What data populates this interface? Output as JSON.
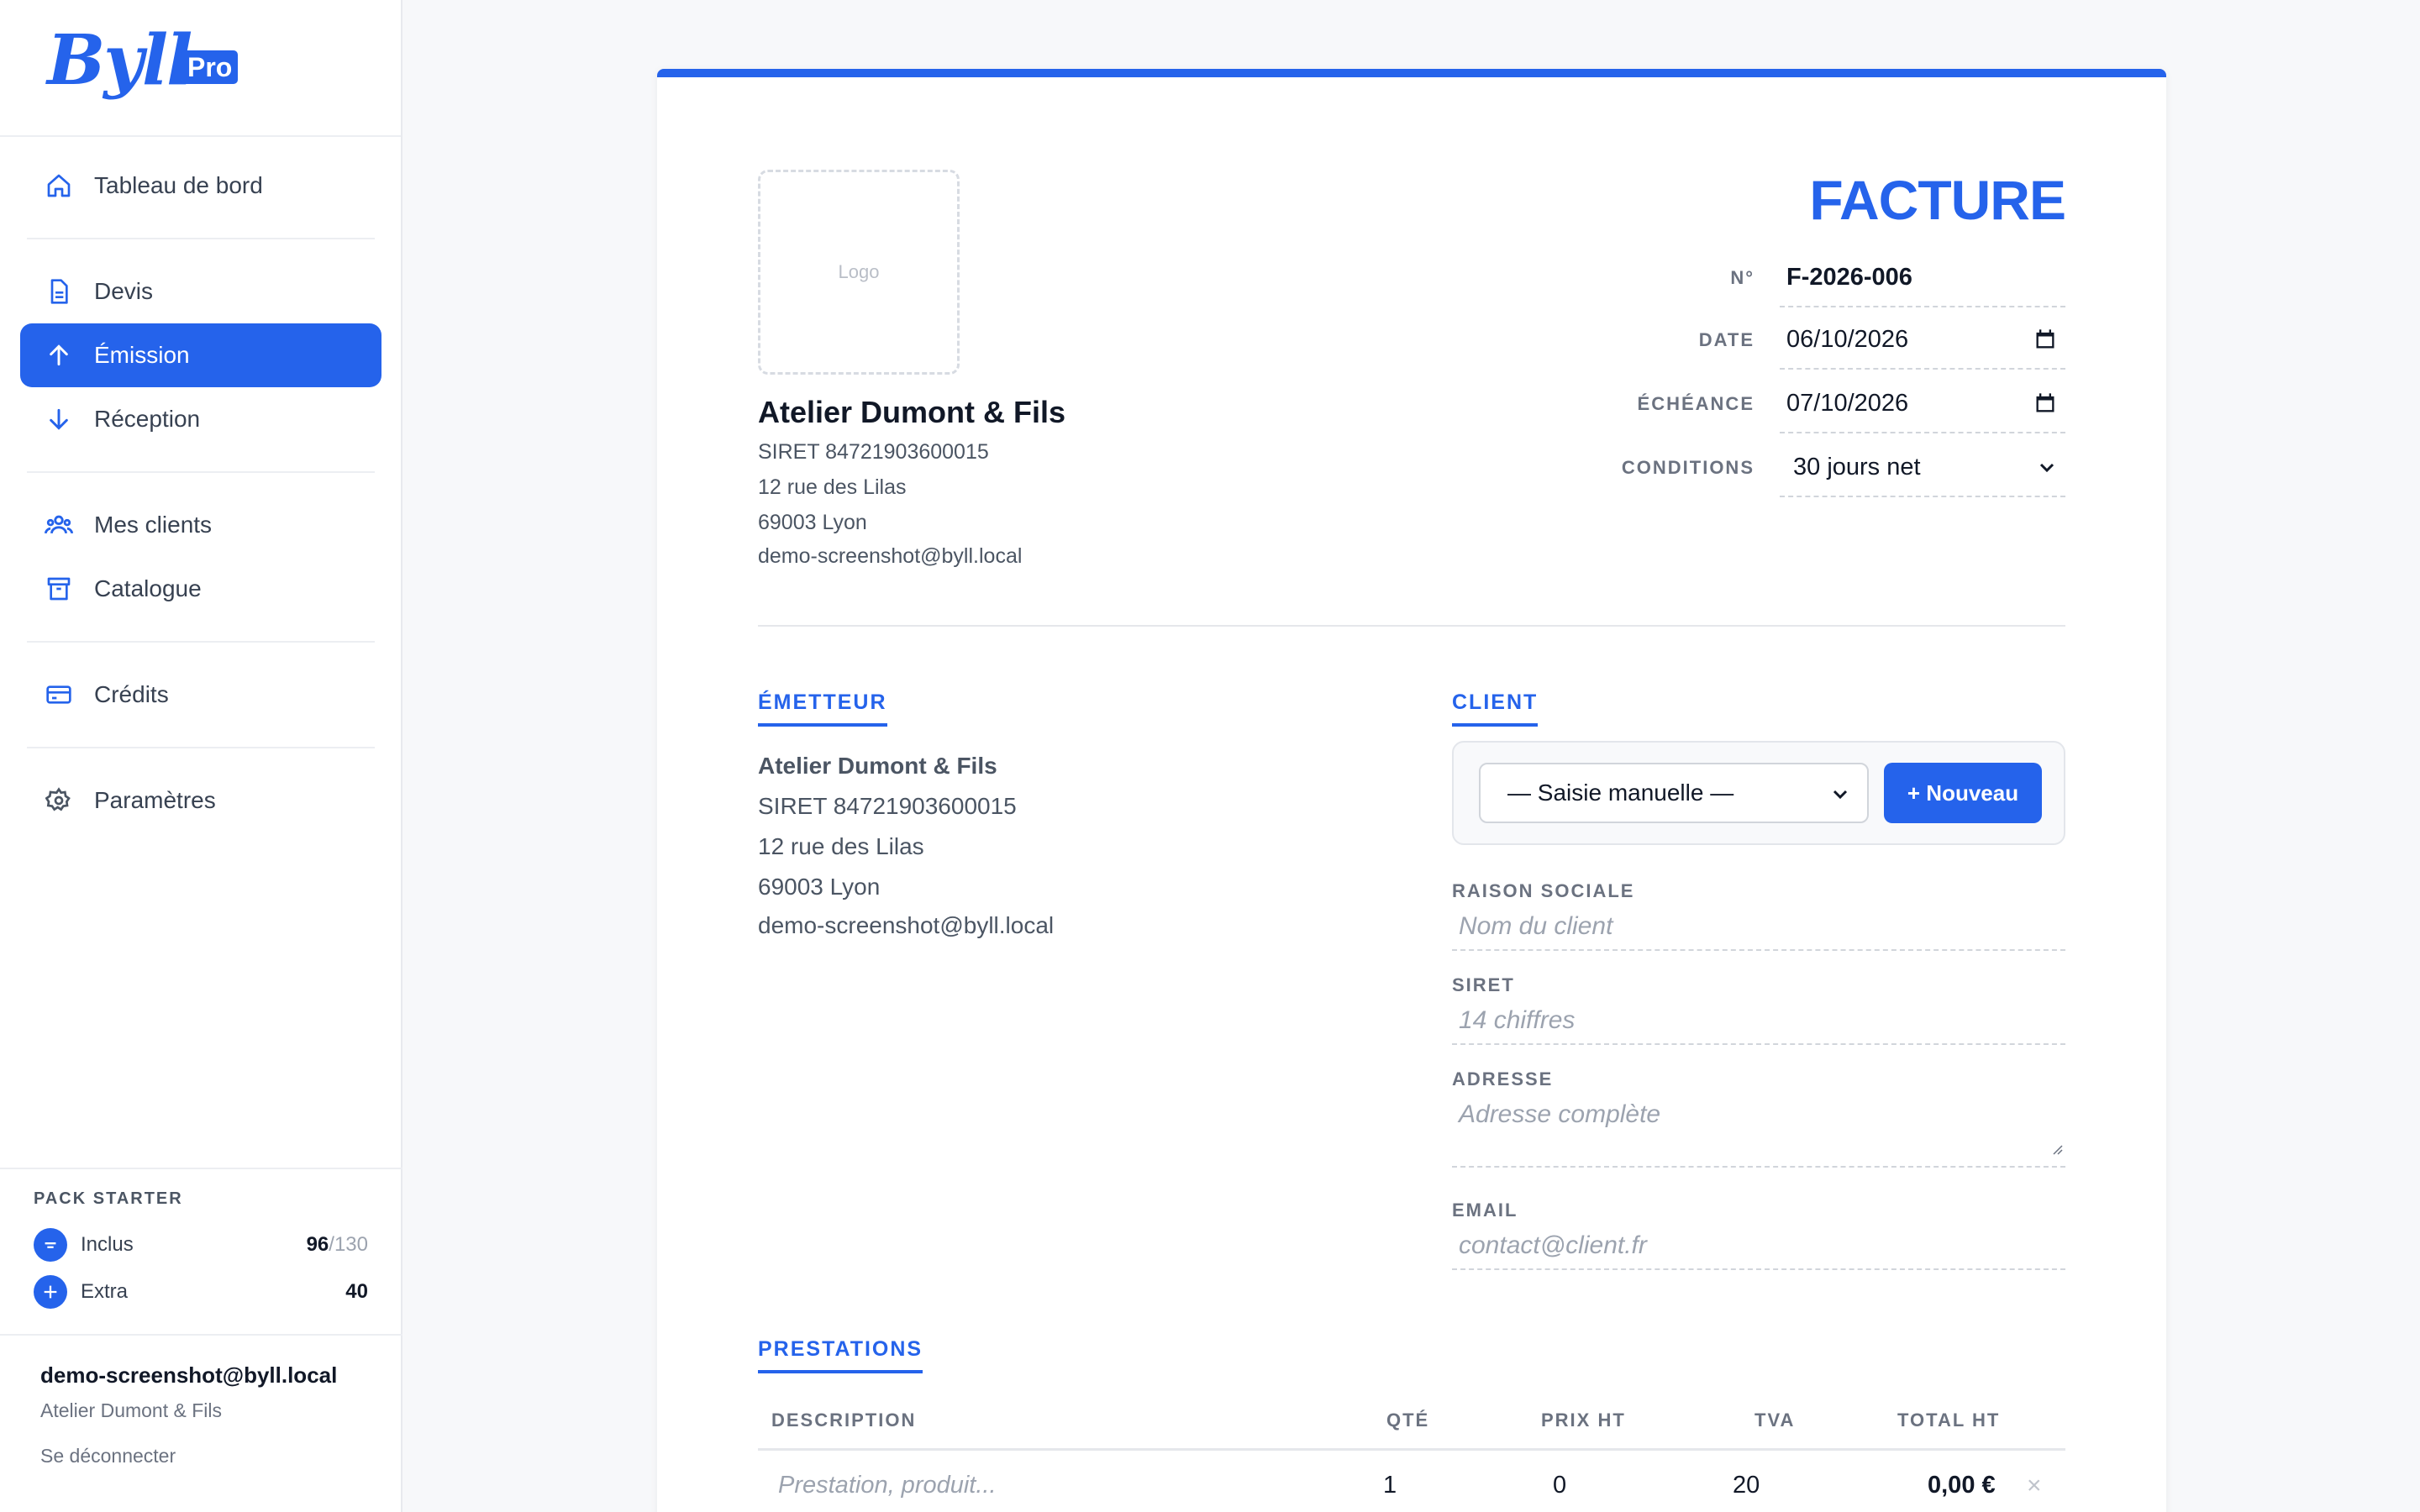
{
  "brand": {
    "name": "Byll",
    "badge": "Pro"
  },
  "nav": {
    "dashboard": "Tableau de bord",
    "quotes": "Devis",
    "emission": "Émission",
    "reception": "Réception",
    "clients": "Mes clients",
    "catalog": "Catalogue",
    "credits": "Crédits",
    "settings": "Paramètres"
  },
  "pack": {
    "title": "PACK STARTER",
    "included_label": "Inclus",
    "included_used": "96",
    "included_total": "/130",
    "extra_label": "Extra",
    "extra_value": "40"
  },
  "user": {
    "email": "demo-screenshot@byll.local",
    "org": "Atelier Dumont & Fils",
    "logout": "Se déconnecter"
  },
  "invoice": {
    "logo_placeholder": "Logo",
    "title": "FACTURE",
    "labels": {
      "number": "N°",
      "date": "DATE",
      "due": "ÉCHÉANCE",
      "terms": "CONDITIONS"
    },
    "number": "F-2026-006",
    "date": "06/10/2026",
    "due": "07/10/2026",
    "terms": "30 jours net"
  },
  "company": {
    "name": "Atelier Dumont & Fils",
    "siret": "SIRET 84721903600015",
    "street": "12 rue des Lilas",
    "city": "69003 Lyon",
    "email": "demo-screenshot@byll.local"
  },
  "emitter": {
    "title": "ÉMETTEUR",
    "name": "Atelier Dumont & Fils",
    "siret": "SIRET 84721903600015",
    "street": "12 rue des Lilas",
    "city": "69003 Lyon",
    "email": "demo-screenshot@byll.local"
  },
  "client": {
    "title": "CLIENT",
    "select_value": "— Saisie manuelle —",
    "new_button": "+ Nouveau",
    "company_label": "RAISON SOCIALE",
    "company_placeholder": "Nom du client",
    "siret_label": "SIRET",
    "siret_placeholder": "14 chiffres",
    "address_label": "ADRESSE",
    "address_placeholder": "Adresse complète",
    "email_label": "EMAIL",
    "email_placeholder": "contact@client.fr"
  },
  "services": {
    "title": "PRESTATIONS",
    "columns": {
      "description": "DESCRIPTION",
      "qty": "QTÉ",
      "price": "PRIX HT",
      "vat": "TVA",
      "total": "TOTAL HT"
    },
    "rows": [
      {
        "description_placeholder": "Prestation, produit...",
        "qty": "1",
        "price": "0",
        "vat": "20",
        "total": "0,00 €"
      }
    ]
  },
  "colors": {
    "accent": "#2563eb"
  }
}
